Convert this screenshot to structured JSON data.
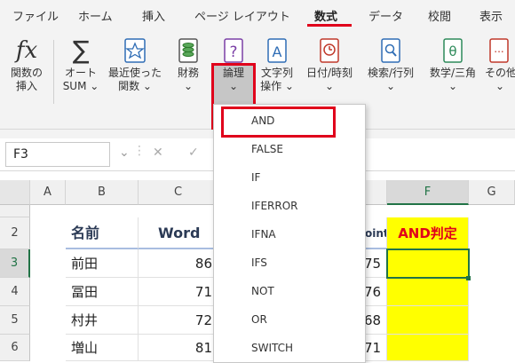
{
  "ribbon_tabs": [
    "ファイル",
    "ホーム",
    "挿入",
    "ページ レイアウト",
    "数式",
    "データ",
    "校閲",
    "表示"
  ],
  "ribbon_groups": {
    "insert_function": {
      "line1": "関数の",
      "line2": "挿入"
    },
    "autosum": {
      "line1": "オート",
      "line2": "SUM ⌄"
    },
    "recent": {
      "line1": "最近使った",
      "line2": "関数 ⌄"
    },
    "financial": {
      "line1": "財務",
      "line2": "⌄"
    },
    "logical": {
      "line1": "論理",
      "line2": "⌄"
    },
    "text": {
      "line1": "文字列",
      "line2": "操作 ⌄"
    },
    "datetime": {
      "line1": "日付/時刻",
      "line2": "⌄"
    },
    "lookup": {
      "line1": "検索/行列",
      "line2": "⌄"
    },
    "math": {
      "line1": "数学/三角",
      "line2": "⌄"
    },
    "more": {
      "line1": "その他",
      "line2": "⌄"
    }
  },
  "formula_bar": {
    "name_box": "F3",
    "cancel": "✕",
    "enter": "✓"
  },
  "columns": [
    "A",
    "B",
    "C",
    "F",
    "G"
  ],
  "rows": [
    "2",
    "3",
    "4",
    "5",
    "6"
  ],
  "header_row": {
    "b": "名前",
    "c": "Word",
    "e_partial": "oint",
    "f": "AND判定"
  },
  "data_rows": [
    {
      "name": "前田",
      "word": "86",
      "e": "75"
    },
    {
      "name": "冨田",
      "word": "71",
      "e": "76"
    },
    {
      "name": "村井",
      "word": "72",
      "e": "68"
    },
    {
      "name": "増山",
      "word": "81",
      "e": "71"
    }
  ],
  "dropdown_items": [
    "AND",
    "FALSE",
    "IF",
    "IFERROR",
    "IFNA",
    "IFS",
    "NOT",
    "OR",
    "SWITCH"
  ],
  "colors": {
    "accent_red": "#e0001b",
    "excel_green": "#217346",
    "highlight_yellow": "#ffff00"
  }
}
